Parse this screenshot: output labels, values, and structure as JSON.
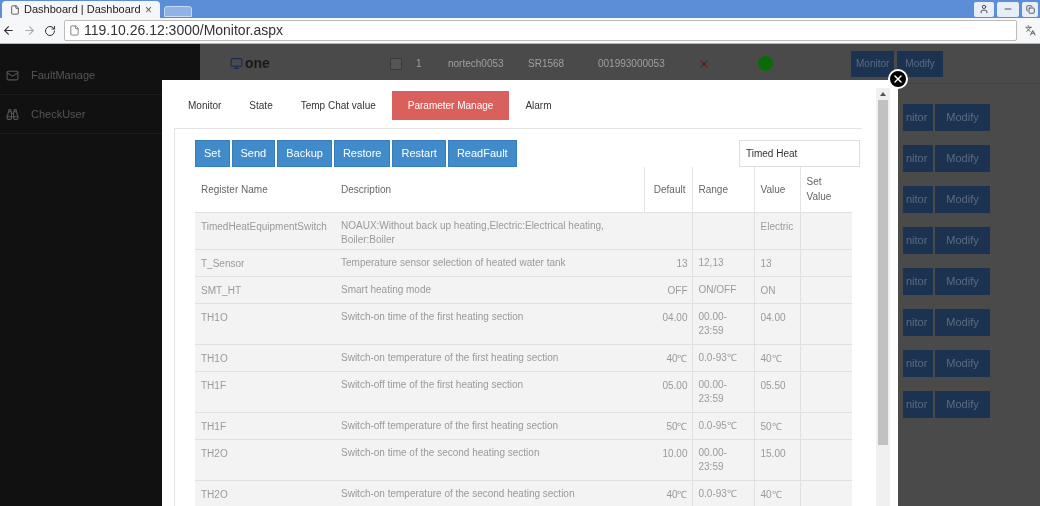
{
  "browser": {
    "tab_title": "Dashboard | Dashboard",
    "tab_close": "×",
    "url": "119.10.26.12:3000/Monitor.aspx"
  },
  "sidebar": {
    "items": [
      {
        "label": "FaultManage",
        "kind": "mail"
      },
      {
        "label": "CheckUser",
        "kind": "binoculars"
      }
    ]
  },
  "background": {
    "tree_node": "one",
    "device": {
      "id": "1",
      "name": "nortech0053",
      "model": "SR1568",
      "serial": "001993000053",
      "checked": false,
      "online": false,
      "fault": false,
      "monitor": "Monitor",
      "modify": "Modify"
    },
    "action_rows": [
      {
        "monitor": "nitor",
        "modify": "Modify"
      },
      {
        "monitor": "nitor",
        "modify": "Modify"
      },
      {
        "monitor": "nitor",
        "modify": "Modify"
      },
      {
        "monitor": "nitor",
        "modify": "Modify"
      },
      {
        "monitor": "nitor",
        "modify": "Modify"
      },
      {
        "monitor": "nitor",
        "modify": "Modify"
      },
      {
        "monitor": "nitor",
        "modify": "Modify"
      },
      {
        "monitor": "nitor",
        "modify": "Modify"
      }
    ]
  },
  "modal": {
    "tabs": [
      {
        "label": "Monitor",
        "selected": false
      },
      {
        "label": "State",
        "selected": false
      },
      {
        "label": "Temp Chat value",
        "selected": false
      },
      {
        "label": "Parameter Manage",
        "selected": true
      },
      {
        "label": "Alarm",
        "selected": false
      }
    ],
    "buttons": [
      "Set",
      "Send",
      "Backup",
      "Restore",
      "Restart",
      "ReadFault"
    ],
    "group_field": {
      "value": "Timed Heat"
    },
    "table": {
      "columns": [
        "Register Name",
        "Description",
        "Default",
        "Range",
        "Value",
        "Set Value"
      ],
      "rows": [
        {
          "name": "TimedHeatEquipmentSwitch",
          "description": "NOAUX:Without back up heating,Electric:Electrical heating, Boiler:Boiler",
          "default": "",
          "range": "",
          "value": "Electric"
        },
        {
          "name": "T_Sensor",
          "description": "Temperature sensor selection of heated water tank",
          "default": "13",
          "range": "12,13",
          "value": "13"
        },
        {
          "name": "SMT_HT",
          "description": "Smart heating mode",
          "default": "OFF",
          "range": "ON/OFF",
          "value": "ON"
        },
        {
          "name": "TH1O",
          "description": "Switch-on time of the first heating section",
          "default": "04.00",
          "range": "00.00-23:59",
          "value": "04.00"
        },
        {
          "name": "TH1O",
          "description": "Switch-on temperature of the first heating section",
          "default": "40℃",
          "range": "0.0-93℃",
          "value": "40℃"
        },
        {
          "name": "TH1F",
          "description": "Switch-off time of the first heating section",
          "default": "05.00",
          "range": "00.00-23:59",
          "value": "05.50"
        },
        {
          "name": "TH1F",
          "description": "Switch-off temperature of the first heating section",
          "default": "50℃",
          "range": "0.0-95℃",
          "value": "50℃"
        },
        {
          "name": "TH2O",
          "description": "Switch-on time of the second heating section",
          "default": "10.00",
          "range": "00.00-23:59",
          "value": "15.00"
        },
        {
          "name": "TH2O",
          "description": "Switch-on temperature of the second heating section",
          "default": "40℃",
          "range": "0.0-93℃",
          "value": "40℃"
        }
      ]
    }
  }
}
